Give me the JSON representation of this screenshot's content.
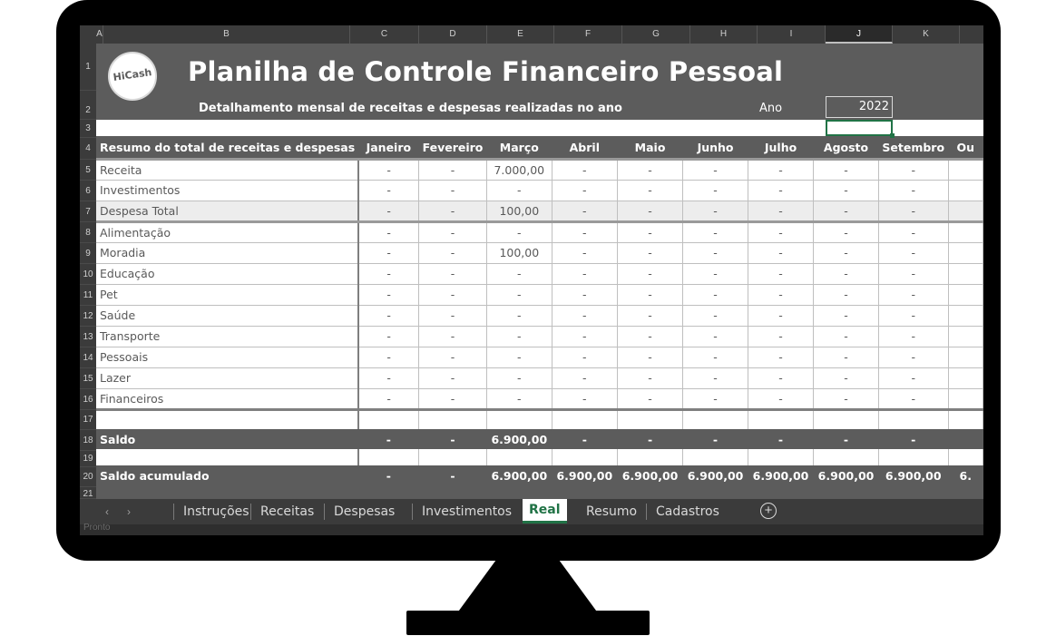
{
  "spreadsheet": {
    "columns": [
      "A",
      "B",
      "C",
      "D",
      "E",
      "F",
      "G",
      "H",
      "I",
      "J",
      "K"
    ],
    "selected_column": "J",
    "row_numbers": [
      "1",
      "2",
      "3",
      "4",
      "5",
      "6",
      "7",
      "8",
      "9",
      "10",
      "11",
      "12",
      "13",
      "14",
      "15",
      "16",
      "17",
      "18",
      "19",
      "20",
      "21"
    ],
    "title": "Planilha de Controle Financeiro Pessoal",
    "subtitle": "Detalhamento mensal de receitas e despesas realizadas no ano",
    "year_label": "Ano",
    "year_value": "2022",
    "logo_text": "HiCash",
    "table": {
      "header_label": "Resumo do total de receitas e despesas",
      "months": [
        "Janeiro",
        "Fevereiro",
        "Março",
        "Abril",
        "Maio",
        "Junho",
        "Julho",
        "Agosto",
        "Setembro",
        "Ou"
      ],
      "rows": [
        {
          "label": "Receita",
          "values": [
            "-",
            "-",
            "7.000,00",
            "-",
            "-",
            "-",
            "-",
            "-",
            "-",
            ""
          ]
        },
        {
          "label": "Investimentos",
          "values": [
            "-",
            "-",
            "-",
            "-",
            "-",
            "-",
            "-",
            "-",
            "-",
            ""
          ]
        },
        {
          "label": "Despesa Total",
          "values": [
            "-",
            "-",
            "100,00",
            "-",
            "-",
            "-",
            "-",
            "-",
            "-",
            ""
          ]
        },
        {
          "label": "Alimentação",
          "values": [
            "-",
            "-",
            "-",
            "-",
            "-",
            "-",
            "-",
            "-",
            "-",
            ""
          ]
        },
        {
          "label": "Moradia",
          "values": [
            "-",
            "-",
            "100,00",
            "-",
            "-",
            "-",
            "-",
            "-",
            "-",
            ""
          ]
        },
        {
          "label": "Educação",
          "values": [
            "-",
            "-",
            "-",
            "-",
            "-",
            "-",
            "-",
            "-",
            "-",
            ""
          ]
        },
        {
          "label": "Pet",
          "values": [
            "-",
            "-",
            "-",
            "-",
            "-",
            "-",
            "-",
            "-",
            "-",
            ""
          ]
        },
        {
          "label": "Saúde",
          "values": [
            "-",
            "-",
            "-",
            "-",
            "-",
            "-",
            "-",
            "-",
            "-",
            ""
          ]
        },
        {
          "label": "Transporte",
          "values": [
            "-",
            "-",
            "-",
            "-",
            "-",
            "-",
            "-",
            "-",
            "-",
            ""
          ]
        },
        {
          "label": "Pessoais",
          "values": [
            "-",
            "-",
            "-",
            "-",
            "-",
            "-",
            "-",
            "-",
            "-",
            ""
          ]
        },
        {
          "label": "Lazer",
          "values": [
            "-",
            "-",
            "-",
            "-",
            "-",
            "-",
            "-",
            "-",
            "-",
            ""
          ]
        },
        {
          "label": "Financeiros",
          "values": [
            "-",
            "-",
            "-",
            "-",
            "-",
            "-",
            "-",
            "-",
            "-",
            ""
          ]
        }
      ],
      "saldo": {
        "label": "Saldo",
        "values": [
          "-",
          "-",
          "6.900,00",
          "-",
          "-",
          "-",
          "-",
          "-",
          "-",
          ""
        ]
      },
      "saldo_acumulado": {
        "label": "Saldo acumulado",
        "values": [
          "-",
          "-",
          "6.900,00",
          "6.900,00",
          "6.900,00",
          "6.900,00",
          "6.900,00",
          "6.900,00",
          "6.900,00",
          "6."
        ]
      }
    },
    "sheet_tabs": [
      "Instruções",
      "Receitas",
      "Despesas",
      "Investimentos",
      "Real",
      "Resumo",
      "Cadastros"
    ],
    "active_tab": "Real",
    "nav_prev": "‹",
    "nav_next": "›",
    "add_sheet": "+",
    "status_text": "Pronto",
    "colors": {
      "accent": "#217346",
      "header_bg": "#5c5c5c",
      "frame": "#000000"
    }
  }
}
